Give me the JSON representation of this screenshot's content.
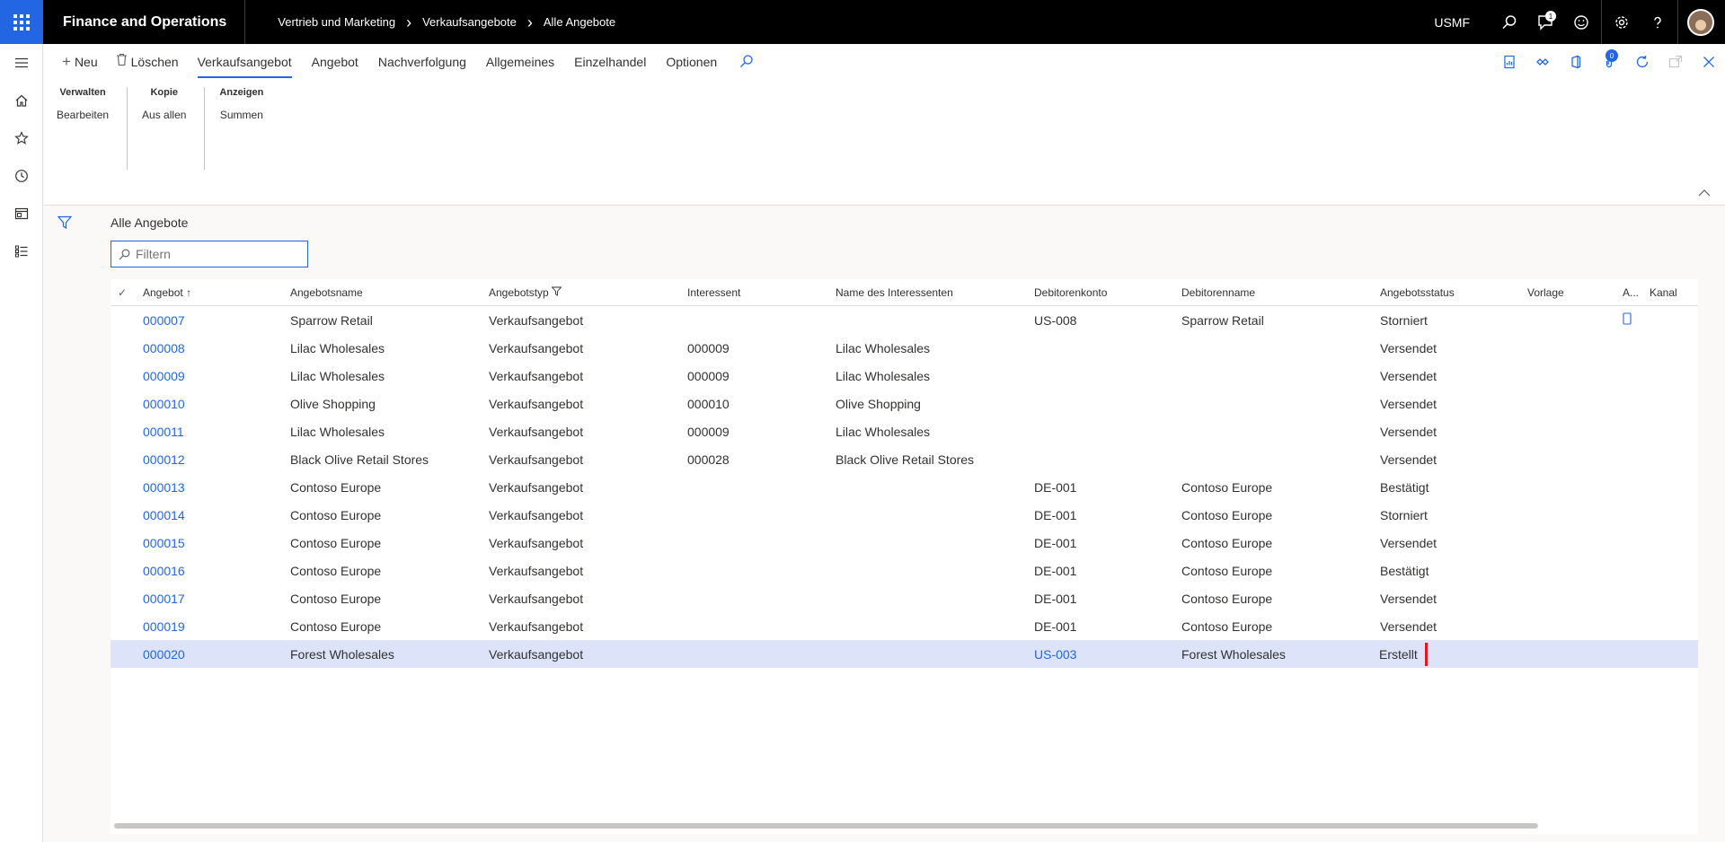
{
  "header": {
    "app_title": "Finance and Operations",
    "breadcrumbs": [
      "Vertrieb und Marketing",
      "Verkaufsangebote",
      "Alle Angebote"
    ],
    "company": "USMF",
    "notification_count": "1"
  },
  "actions": {
    "new_label": "Neu",
    "delete_label": "Löschen",
    "tabs": [
      "Verkaufsangebot",
      "Angebot",
      "Nachverfolgung",
      "Allgemeines",
      "Einzelhandel",
      "Optionen"
    ],
    "attachments_count": "0"
  },
  "groups": [
    {
      "title": "Verwalten",
      "item": "Bearbeiten"
    },
    {
      "title": "Kopie",
      "item": "Aus allen"
    },
    {
      "title": "Anzeigen",
      "item": "Summen"
    }
  ],
  "list": {
    "title": "Alle Angebote",
    "filter_placeholder": "Filtern"
  },
  "columns": [
    "Angebot",
    "Angebotsname",
    "Angebotstyp",
    "Interessent",
    "Name des Interessenten",
    "Debitorenkonto",
    "Debitorenname",
    "Angebotsstatus",
    "Vorlage",
    "A...",
    "Kanal"
  ],
  "rows": [
    {
      "id": "000007",
      "name": "Sparrow Retail",
      "type": "Verkaufsangebot",
      "prospect": "",
      "prospect_name": "",
      "account": "US-008",
      "customer": "Sparrow Retail",
      "status": "Storniert"
    },
    {
      "id": "000008",
      "name": "Lilac Wholesales",
      "type": "Verkaufsangebot",
      "prospect": "000009",
      "prospect_name": "Lilac Wholesales",
      "account": "",
      "customer": "",
      "status": "Versendet"
    },
    {
      "id": "000009",
      "name": "Lilac Wholesales",
      "type": "Verkaufsangebot",
      "prospect": "000009",
      "prospect_name": "Lilac Wholesales",
      "account": "",
      "customer": "",
      "status": "Versendet"
    },
    {
      "id": "000010",
      "name": "Olive Shopping",
      "type": "Verkaufsangebot",
      "prospect": "000010",
      "prospect_name": "Olive Shopping",
      "account": "",
      "customer": "",
      "status": "Versendet"
    },
    {
      "id": "000011",
      "name": "Lilac Wholesales",
      "type": "Verkaufsangebot",
      "prospect": "000009",
      "prospect_name": "Lilac Wholesales",
      "account": "",
      "customer": "",
      "status": "Versendet"
    },
    {
      "id": "000012",
      "name": "Black Olive Retail Stores",
      "type": "Verkaufsangebot",
      "prospect": "000028",
      "prospect_name": "Black Olive Retail Stores",
      "account": "",
      "customer": "",
      "status": "Versendet"
    },
    {
      "id": "000013",
      "name": "Contoso Europe",
      "type": "Verkaufsangebot",
      "prospect": "",
      "prospect_name": "",
      "account": "DE-001",
      "customer": "Contoso Europe",
      "status": "Bestätigt"
    },
    {
      "id": "000014",
      "name": "Contoso Europe",
      "type": "Verkaufsangebot",
      "prospect": "",
      "prospect_name": "",
      "account": "DE-001",
      "customer": "Contoso Europe",
      "status": "Storniert"
    },
    {
      "id": "000015",
      "name": "Contoso Europe",
      "type": "Verkaufsangebot",
      "prospect": "",
      "prospect_name": "",
      "account": "DE-001",
      "customer": "Contoso Europe",
      "status": "Versendet"
    },
    {
      "id": "000016",
      "name": "Contoso Europe",
      "type": "Verkaufsangebot",
      "prospect": "",
      "prospect_name": "",
      "account": "DE-001",
      "customer": "Contoso Europe",
      "status": "Bestätigt"
    },
    {
      "id": "000017",
      "name": "Contoso Europe",
      "type": "Verkaufsangebot",
      "prospect": "",
      "prospect_name": "",
      "account": "DE-001",
      "customer": "Contoso Europe",
      "status": "Versendet"
    },
    {
      "id": "000019",
      "name": "Contoso Europe",
      "type": "Verkaufsangebot",
      "prospect": "",
      "prospect_name": "",
      "account": "DE-001",
      "customer": "Contoso Europe",
      "status": "Versendet"
    },
    {
      "id": "000020",
      "name": "Forest Wholesales",
      "type": "Verkaufsangebot",
      "prospect": "",
      "prospect_name": "",
      "account": "US-003",
      "customer": "Forest Wholesales",
      "status": "Erstellt"
    }
  ],
  "selected_row_index": 12,
  "colors": {
    "accent": "#2266e3",
    "selected_row": "#dde4fa",
    "highlight": "#e3191e"
  }
}
